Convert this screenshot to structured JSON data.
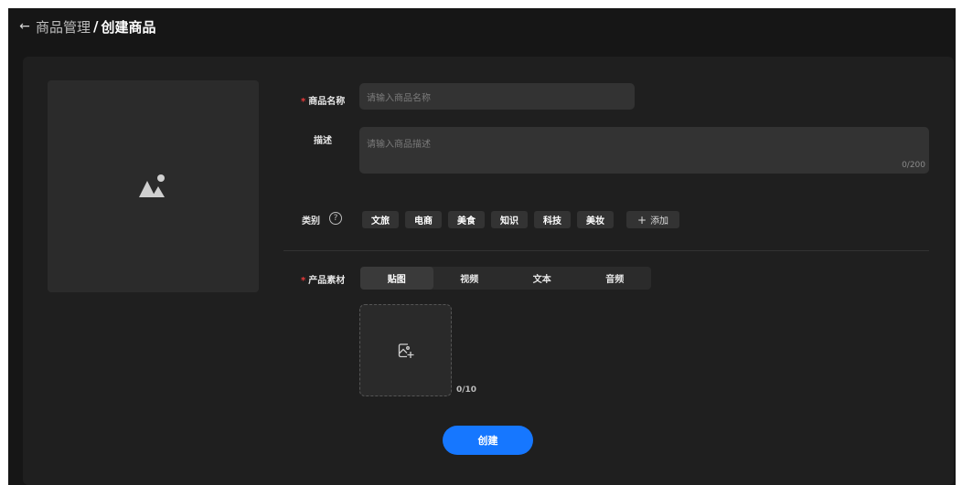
{
  "header": {
    "back_icon": "←",
    "breadcrumb_parent": "商品管理",
    "breadcrumb_separator": "/",
    "breadcrumb_current": "创建商品"
  },
  "cover": {
    "icon": "image-placeholder-icon"
  },
  "form": {
    "name": {
      "label": "商品名称",
      "required_mark": "*",
      "placeholder": "请输入商品名称"
    },
    "description": {
      "label": "描述",
      "placeholder": "请输入商品描述",
      "counter": "0/200"
    },
    "category": {
      "label": "类别",
      "help_icon": "?",
      "options": [
        "文旅",
        "电商",
        "美食",
        "知识",
        "科技",
        "美妆"
      ],
      "add_icon": "+",
      "add_label": "添加"
    },
    "material": {
      "label": "产品素材",
      "required_mark": "*",
      "tabs": [
        "贴图",
        "视频",
        "文本",
        "音频"
      ],
      "active_tab": "贴图",
      "upload_count": "0/10"
    }
  },
  "submit": {
    "label": "创建"
  },
  "colors": {
    "accent": "#1677ff",
    "required": "#e83a3a",
    "background": "#161616",
    "panel": "#1f1f1f"
  }
}
